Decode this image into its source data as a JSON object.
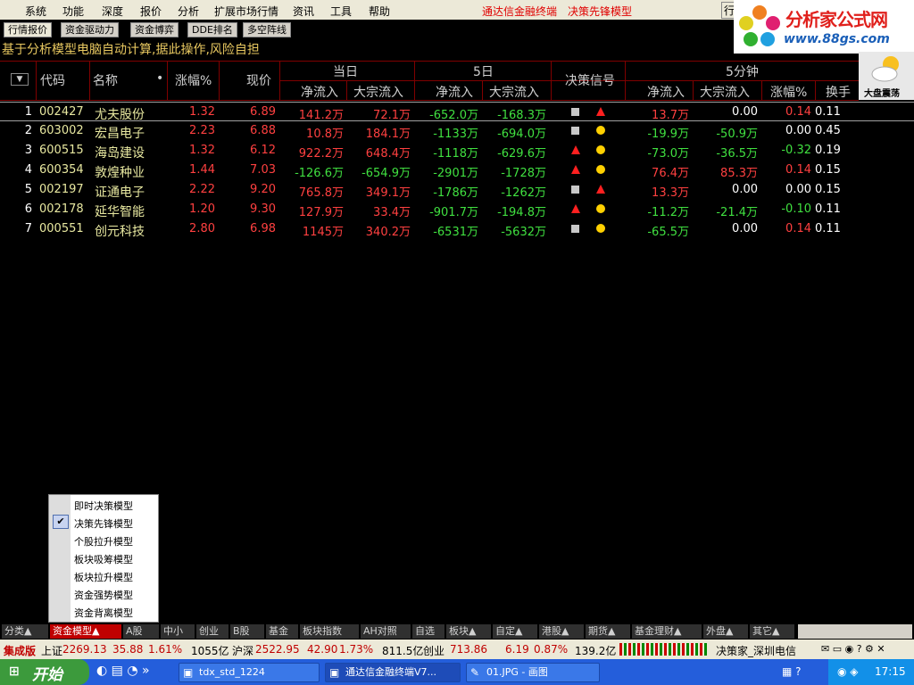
{
  "menu": {
    "items": [
      "系统",
      "功能",
      "深度",
      "报价",
      "分析",
      "扩展市场行情",
      "资讯",
      "工具",
      "帮助"
    ],
    "right1": "通达信金融终端",
    "right2": "决策先锋模型",
    "right3": "行"
  },
  "logo": {
    "text1": "分析家公式网",
    "text2": "www.88gs.com"
  },
  "tabs": [
    "行情报价",
    "资金驱动力",
    "资金博弈",
    "DDE排名",
    "多空阵线"
  ],
  "notice": "基于分析模型电脑自动计算,据此操作,风险自担",
  "weather": {
    "label": "大盘震荡",
    "icon": "cloud-sun-icon"
  },
  "header": {
    "code": "代码",
    "name": "名称",
    "dot": "•",
    "change": "涨幅%",
    "price": "现价",
    "group_today": "当日",
    "group_5day": "5日",
    "signal": "决策信号",
    "group_5min": "5分钟",
    "net_inflow": "净流入",
    "block_inflow": "大宗流入",
    "change_pct": "涨幅%",
    "turnover": "换手"
  },
  "rows": [
    {
      "no": "1",
      "code": "002427",
      "name": "尤夫股份",
      "change": "1.32",
      "price": "6.89",
      "d_net": "141.2万",
      "d_block": "72.1万",
      "w_net": "-652.0万",
      "w_block": "-168.3万",
      "sig": [
        "square",
        "triangle"
      ],
      "m_net": "13.7万",
      "m_block": "0.00",
      "m_chg": "0.14",
      "turn": "0.11"
    },
    {
      "no": "2",
      "code": "603002",
      "name": "宏昌电子",
      "change": "2.23",
      "price": "6.88",
      "d_net": "10.8万",
      "d_block": "184.1万",
      "w_net": "-1133万",
      "w_block": "-694.0万",
      "sig": [
        "square",
        "circle"
      ],
      "m_net": "-19.9万",
      "m_block": "-50.9万",
      "m_chg": "0.00",
      "turn": "0.45"
    },
    {
      "no": "3",
      "code": "600515",
      "name": "海岛建设",
      "change": "1.32",
      "price": "6.12",
      "d_net": "922.2万",
      "d_block": "648.4万",
      "w_net": "-1118万",
      "w_block": "-629.6万",
      "sig": [
        "triangle",
        "circle"
      ],
      "m_net": "-73.0万",
      "m_block": "-36.5万",
      "m_chg": "-0.32",
      "turn": "0.19"
    },
    {
      "no": "4",
      "code": "600354",
      "name": "敦煌种业",
      "change": "1.44",
      "price": "7.03",
      "d_net": "-126.6万",
      "d_block": "-654.9万",
      "w_net": "-2901万",
      "w_block": "-1728万",
      "sig": [
        "triangle",
        "circle"
      ],
      "m_net": "76.4万",
      "m_block": "85.3万",
      "m_chg": "0.14",
      "turn": "0.15"
    },
    {
      "no": "5",
      "code": "002197",
      "name": "证通电子",
      "change": "2.22",
      "price": "9.20",
      "d_net": "765.8万",
      "d_block": "349.1万",
      "w_net": "-1786万",
      "w_block": "-1262万",
      "sig": [
        "square",
        "triangle"
      ],
      "m_net": "13.3万",
      "m_block": "0.00",
      "m_chg": "0.00",
      "turn": "0.15"
    },
    {
      "no": "6",
      "code": "002178",
      "name": "延华智能",
      "change": "1.20",
      "price": "9.30",
      "d_net": "127.9万",
      "d_block": "33.4万",
      "w_net": "-901.7万",
      "w_block": "-194.8万",
      "sig": [
        "triangle",
        "circle"
      ],
      "m_net": "-11.2万",
      "m_block": "-21.4万",
      "m_chg": "-0.10",
      "turn": "0.11"
    },
    {
      "no": "7",
      "code": "000551",
      "name": "创元科技",
      "change": "2.80",
      "price": "6.98",
      "d_net": "1145万",
      "d_block": "340.2万",
      "w_net": "-6531万",
      "w_block": "-5632万",
      "sig": [
        "square",
        "circle"
      ],
      "m_net": "-65.5万",
      "m_block": "0.00",
      "m_chg": "0.14",
      "turn": "0.11"
    }
  ],
  "popup": {
    "items": [
      "即时决策模型",
      "决策先锋模型",
      "个股拉升模型",
      "板块吸筹模型",
      "板块拉升模型",
      "资金强势模型",
      "资金背离模型"
    ],
    "checked": "决策先锋模型"
  },
  "bottom_tabs": [
    "分类▲",
    "资金模型▲",
    "A股",
    "中小",
    "创业",
    "B股",
    "基金",
    "板块指数",
    "AH对照",
    "自选",
    "板块▲",
    "自定▲",
    "港股▲",
    "期货▲",
    "基金理财▲",
    "外盘▲",
    "其它▲"
  ],
  "ticker": {
    "brand": "集成版",
    "sh_label": "上证",
    "sh_val": "2269.13",
    "sh_chg": "35.88",
    "sh_pct": "1.61%",
    "sh_amt": "1055亿",
    "hs_label": "沪深",
    "hs_val": "2522.95",
    "hs_chg": "42.90",
    "hs_pct": "1.73%",
    "hs_amt": "811.5亿",
    "cy_label": "创业",
    "cy_val": "713.86",
    "cy_chg": "6.19",
    "cy_pct": "0.87%",
    "cy_amt": "139.2亿",
    "right": "决策家_深圳电信"
  },
  "taskbar": {
    "start": "开始",
    "items": [
      "tdx_std_1224",
      "通达信金融终端V7...",
      "01.JPG - 画图"
    ],
    "time": "17:15"
  },
  "colors": {
    "up": "#ff4040",
    "down": "#40e040",
    "grid": "#800000"
  }
}
